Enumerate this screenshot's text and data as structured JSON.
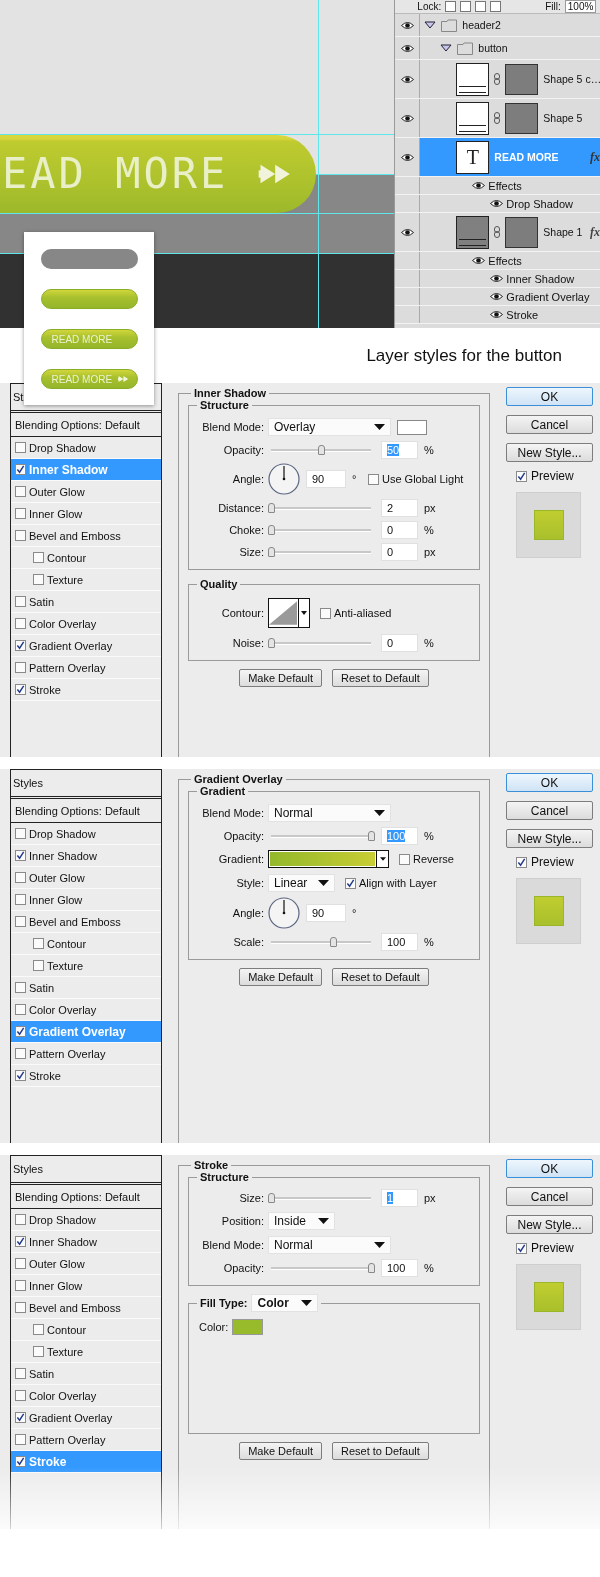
{
  "canvas": {
    "button_label": "EAD MORE",
    "preview_buttons": [
      {
        "kind": "flat"
      },
      {
        "kind": "glossy"
      },
      {
        "kind": "label",
        "label": "READ MORE"
      },
      {
        "kind": "label-arrow",
        "label": "READ MORE"
      }
    ]
  },
  "layers_panel": {
    "lock_label": "Lock:",
    "fill_label": "Fill:",
    "fill_value": "100%",
    "layers": [
      {
        "kind": "group",
        "name": "header2",
        "visible": true,
        "expanded": true,
        "children": [
          {
            "kind": "group",
            "name": "button",
            "visible": true,
            "expanded": true,
            "children": [
              {
                "kind": "shape",
                "name": "Shape 5 c…",
                "visible": true,
                "selected": false,
                "color": "#ffffff"
              },
              {
                "kind": "shape",
                "name": "Shape 5",
                "visible": true,
                "selected": false,
                "color": "#ffffff"
              },
              {
                "kind": "text",
                "icon": "T",
                "name": "READ MORE",
                "visible": true,
                "selected": true,
                "fx": "fx",
                "effects": {
                  "label": "Effects",
                  "items": [
                    {
                      "name": "Drop Shadow"
                    }
                  ]
                }
              },
              {
                "kind": "shape",
                "name": "Shape 1",
                "visible": true,
                "selected": false,
                "color": "#808080",
                "fx": "fx",
                "effects": {
                  "label": "Effects",
                  "items": [
                    {
                      "name": "Inner Shadow"
                    },
                    {
                      "name": "Gradient Overlay"
                    },
                    {
                      "name": "Stroke"
                    }
                  ]
                }
              }
            ]
          }
        ]
      }
    ]
  },
  "caption": "Layer styles for the button",
  "dialogs": [
    {
      "styles_header": "St",
      "blending": "Blending Options: Default",
      "options": [
        {
          "label": "Drop Shadow",
          "checked": false,
          "selected": false
        },
        {
          "label": "Inner Shadow",
          "checked": true,
          "selected": true
        },
        {
          "label": "Outer Glow",
          "checked": false,
          "selected": false
        },
        {
          "label": "Inner Glow",
          "checked": false,
          "selected": false
        },
        {
          "label": "Bevel and Emboss",
          "checked": false,
          "selected": false,
          "children": [
            {
              "label": "Contour",
              "checked": false,
              "selected": false
            },
            {
              "label": "Texture",
              "checked": false,
              "selected": false
            }
          ]
        },
        {
          "label": "Satin",
          "checked": false,
          "selected": false
        },
        {
          "label": "Color Overlay",
          "checked": false,
          "selected": false
        },
        {
          "label": "Gradient Overlay",
          "checked": true,
          "selected": false
        },
        {
          "label": "Pattern Overlay",
          "checked": false,
          "selected": false
        },
        {
          "label": "Stroke",
          "checked": true,
          "selected": false
        }
      ],
      "panel": {
        "title": "Inner Shadow",
        "groups": [
          {
            "title": "Structure",
            "rows": [
              {
                "kind": "dropdown",
                "label": "Blend Mode:",
                "value": "Overlay",
                "color": "#ffffff"
              },
              {
                "kind": "slider",
                "label": "Opacity:",
                "level": 0.5,
                "value": "50",
                "unit": "%",
                "focused": true
              },
              {
                "kind": "angle",
                "label": "Angle:",
                "value": "90",
                "unit": "°",
                "option": {
                  "label": "Use Global Light",
                  "checked": false
                }
              },
              {
                "kind": "slider",
                "label": "Distance:",
                "level": 0,
                "value": "2",
                "unit": "px",
                "focused": false
              },
              {
                "kind": "slider",
                "label": "Choke:",
                "level": 0,
                "value": "0",
                "unit": "%",
                "focused": false
              },
              {
                "kind": "slider",
                "label": "Size:",
                "level": 0,
                "value": "0",
                "unit": "px",
                "focused": false
              }
            ]
          },
          {
            "title": "Quality",
            "rows": [
              {
                "kind": "contour",
                "label": "Contour:",
                "option": {
                  "label": "Anti-aliased",
                  "checked": false
                }
              },
              {
                "kind": "slider",
                "label": "Noise:",
                "level": 0,
                "value": "0",
                "unit": "%",
                "focused": false
              }
            ]
          }
        ],
        "actions": [
          "Make Default",
          "Reset to Default"
        ]
      },
      "buttons": [
        {
          "label": "OK",
          "default": true
        },
        {
          "label": "Cancel",
          "default": false
        },
        {
          "label": "New Style...",
          "default": false
        }
      ],
      "preview": {
        "label": "Preview",
        "checked": true
      }
    },
    {
      "styles_header": "Styles",
      "blending": "Blending Options: Default",
      "options": [
        {
          "label": "Drop Shadow",
          "checked": false,
          "selected": false
        },
        {
          "label": "Inner Shadow",
          "checked": true,
          "selected": false
        },
        {
          "label": "Outer Glow",
          "checked": false,
          "selected": false
        },
        {
          "label": "Inner Glow",
          "checked": false,
          "selected": false
        },
        {
          "label": "Bevel and Emboss",
          "checked": false,
          "selected": false,
          "children": [
            {
              "label": "Contour",
              "checked": false,
              "selected": false
            },
            {
              "label": "Texture",
              "checked": false,
              "selected": false
            }
          ]
        },
        {
          "label": "Satin",
          "checked": false,
          "selected": false
        },
        {
          "label": "Color Overlay",
          "checked": false,
          "selected": false
        },
        {
          "label": "Gradient Overlay",
          "checked": true,
          "selected": true
        },
        {
          "label": "Pattern Overlay",
          "checked": false,
          "selected": false
        },
        {
          "label": "Stroke",
          "checked": true,
          "selected": false
        }
      ],
      "panel": {
        "title": "Gradient Overlay",
        "groups": [
          {
            "title": "Gradient",
            "rows": [
              {
                "kind": "dropdown",
                "label": "Blend Mode:",
                "value": "Normal"
              },
              {
                "kind": "slider",
                "label": "Opacity:",
                "level": 1,
                "value": "100",
                "unit": "%",
                "focused": true
              },
              {
                "kind": "gradient",
                "label": "Gradient:",
                "option": {
                  "label": "Reverse",
                  "checked": false
                }
              },
              {
                "kind": "short-dropdown",
                "label": "Style:",
                "value": "Linear",
                "option": {
                  "label": "Align with Layer",
                  "checked": true
                }
              },
              {
                "kind": "angle",
                "label": "Angle:",
                "value": "90",
                "unit": "°"
              },
              {
                "kind": "slider",
                "label": "Scale:",
                "level": 0.62,
                "value": "100",
                "unit": "%",
                "focused": false
              }
            ]
          }
        ],
        "actions": [
          "Make Default",
          "Reset to Default"
        ]
      },
      "buttons": [
        {
          "label": "OK",
          "default": true
        },
        {
          "label": "Cancel",
          "default": false
        },
        {
          "label": "New Style...",
          "default": false
        }
      ],
      "preview": {
        "label": "Preview",
        "checked": true
      }
    },
    {
      "styles_header": "Styles",
      "blending": "Blending Options: Default",
      "options": [
        {
          "label": "Drop Shadow",
          "checked": false,
          "selected": false
        },
        {
          "label": "Inner Shadow",
          "checked": true,
          "selected": false
        },
        {
          "label": "Outer Glow",
          "checked": false,
          "selected": false
        },
        {
          "label": "Inner Glow",
          "checked": false,
          "selected": false
        },
        {
          "label": "Bevel and Emboss",
          "checked": false,
          "selected": false,
          "children": [
            {
              "label": "Contour",
              "checked": false,
              "selected": false
            },
            {
              "label": "Texture",
              "checked": false,
              "selected": false
            }
          ]
        },
        {
          "label": "Satin",
          "checked": false,
          "selected": false
        },
        {
          "label": "Color Overlay",
          "checked": false,
          "selected": false
        },
        {
          "label": "Gradient Overlay",
          "checked": true,
          "selected": false
        },
        {
          "label": "Pattern Overlay",
          "checked": false,
          "selected": false
        },
        {
          "label": "Stroke",
          "checked": true,
          "selected": true
        }
      ],
      "panel": {
        "title": "Stroke",
        "groups": [
          {
            "title": "Structure",
            "rows": [
              {
                "kind": "slider",
                "label": "Size:",
                "level": 0,
                "value": "1",
                "unit": "px",
                "focused": true
              },
              {
                "kind": "short-dropdown",
                "label": "Position:",
                "value": "Inside"
              },
              {
                "kind": "dropdown",
                "label": "Blend Mode:",
                "value": "Normal"
              },
              {
                "kind": "slider",
                "label": "Opacity:",
                "level": 1,
                "value": "100",
                "unit": "%",
                "focused": false
              }
            ]
          },
          {
            "legend_dropdown": {
              "label": "Fill Type:",
              "value": "Color"
            },
            "rows": [
              {
                "kind": "color",
                "label": "Color:",
                "color": "#97bb2b"
              }
            ]
          }
        ],
        "actions": [
          "Make Default",
          "Reset to Default"
        ]
      },
      "buttons": [
        {
          "label": "OK",
          "default": true
        },
        {
          "label": "Cancel",
          "default": false
        },
        {
          "label": "New Style...",
          "default": false
        }
      ],
      "preview": {
        "label": "Preview",
        "checked": true
      }
    }
  ]
}
